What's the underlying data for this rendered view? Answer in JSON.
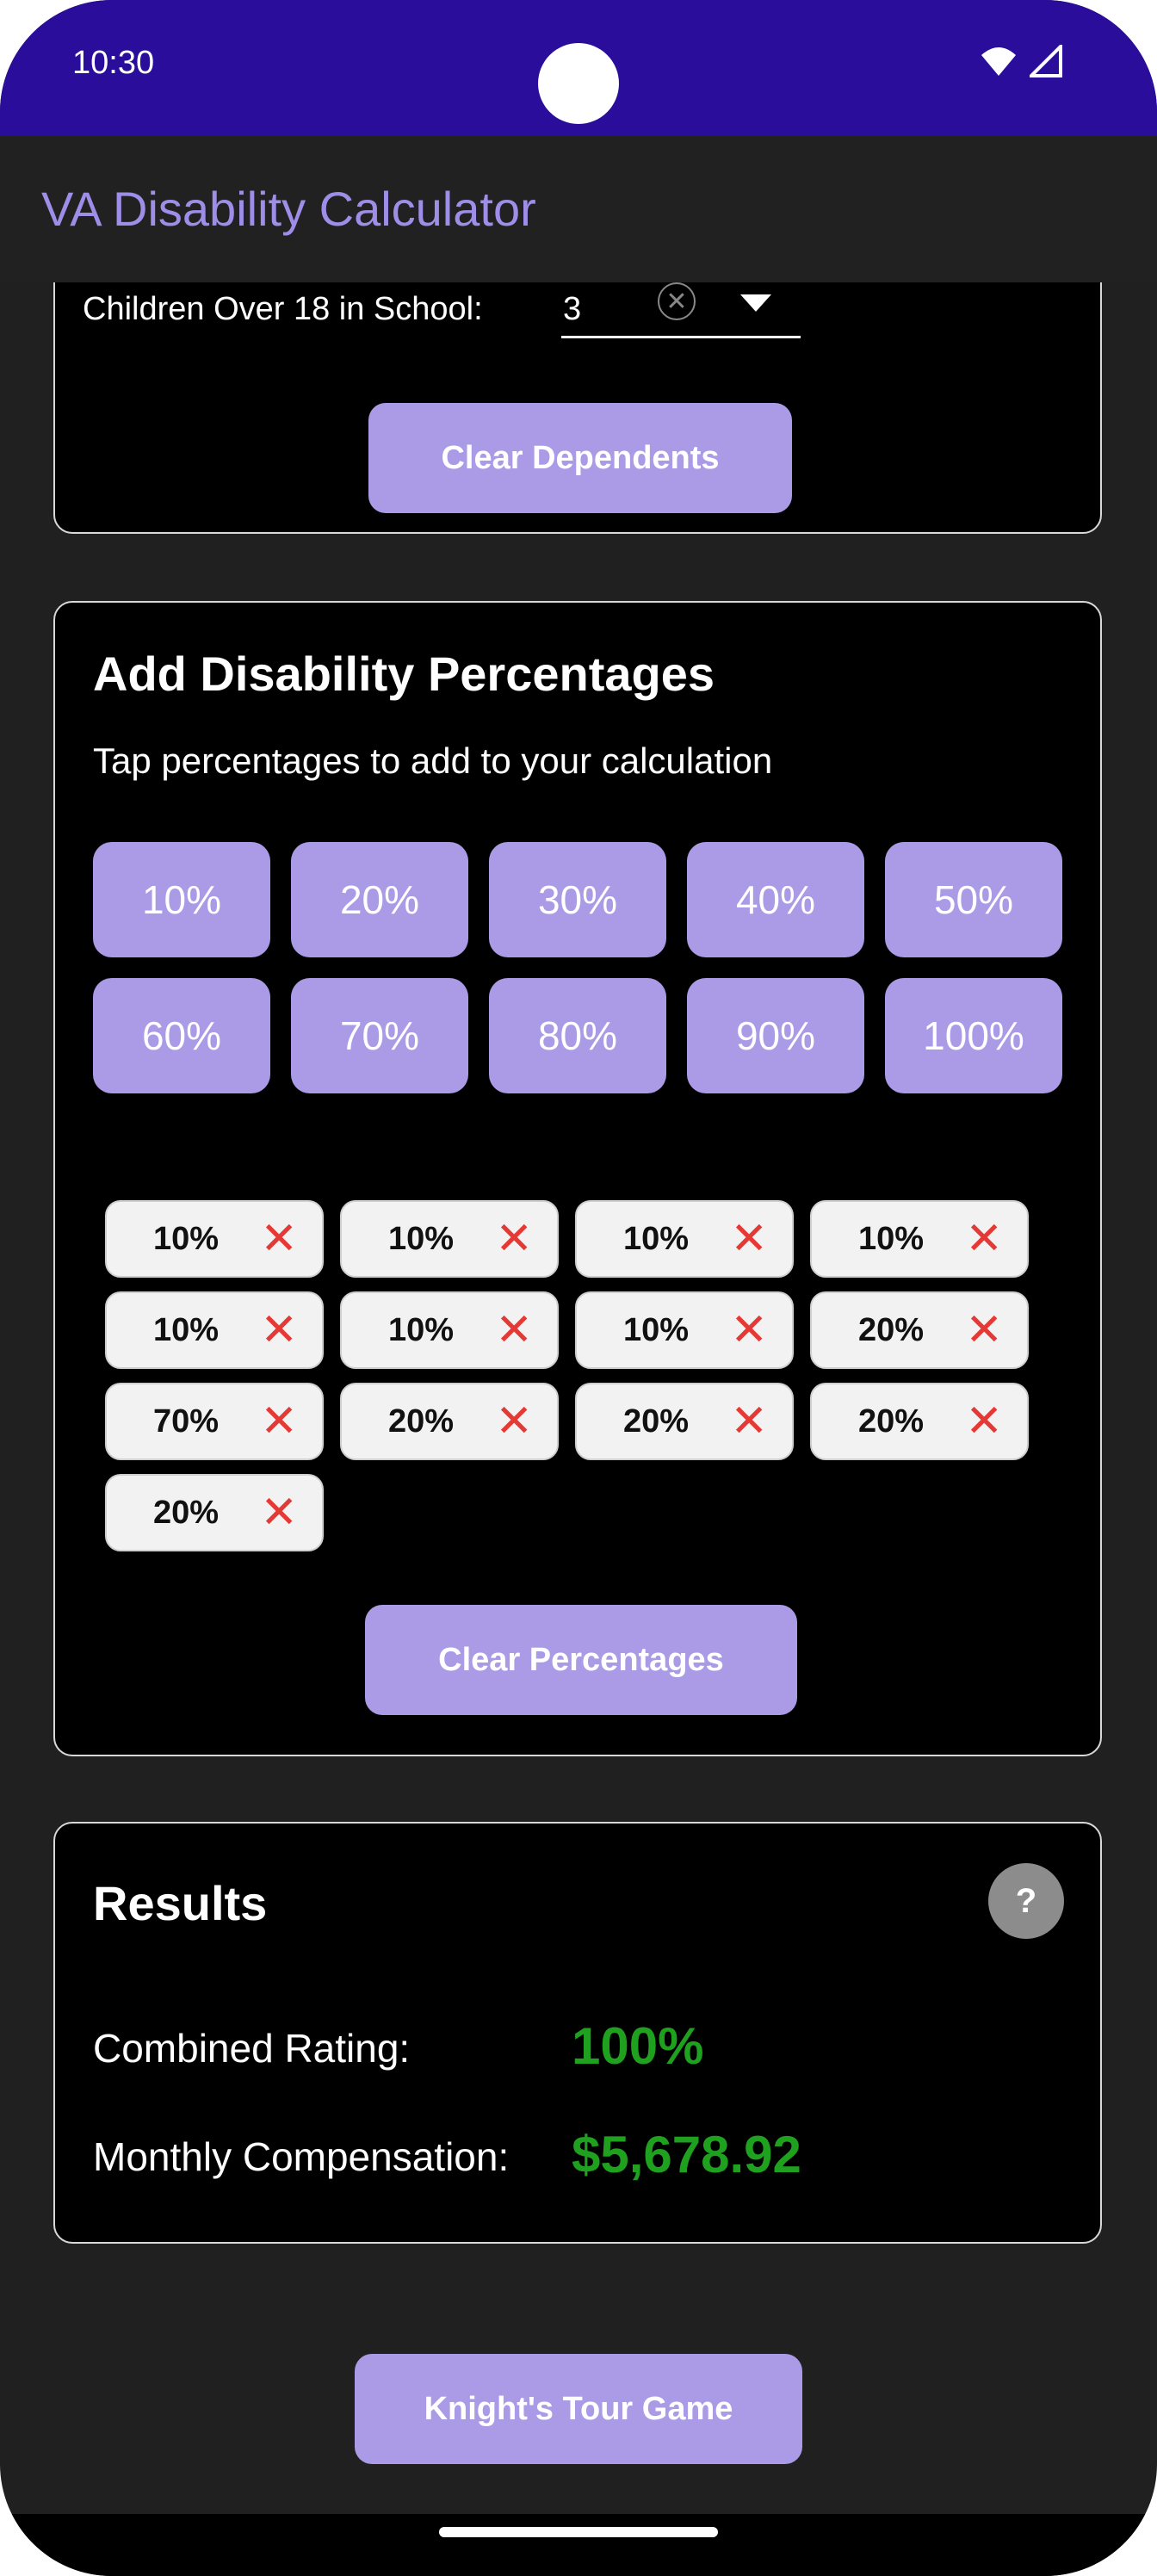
{
  "status_bar": {
    "time": "10:30"
  },
  "app_bar": {
    "title": "VA Disability Calculator"
  },
  "dependents": {
    "children_school_label": "Children Over 18 in School:",
    "children_school_value": "3",
    "clear_button": "Clear Dependents"
  },
  "percentages": {
    "title": "Add Disability Percentages",
    "subtitle": "Tap percentages to add to your calculation",
    "options": [
      "10%",
      "20%",
      "30%",
      "40%",
      "50%",
      "60%",
      "70%",
      "80%",
      "90%",
      "100%"
    ],
    "selected": [
      "10%",
      "10%",
      "10%",
      "10%",
      "10%",
      "10%",
      "10%",
      "20%",
      "70%",
      "20%",
      "20%",
      "20%",
      "20%"
    ],
    "clear_button": "Clear Percentages"
  },
  "results": {
    "title": "Results",
    "help": "?",
    "combined_label": "Combined Rating:",
    "combined_value": "100%",
    "compensation_label": "Monthly Compensation:",
    "compensation_value": "$5,678.92",
    "value_color": "#1fa11f"
  },
  "game_button": "Knight's Tour Game",
  "colors": {
    "accent": "#ab9be6",
    "status_bar": "#2a0d9b",
    "title": "#9f8ee8"
  }
}
